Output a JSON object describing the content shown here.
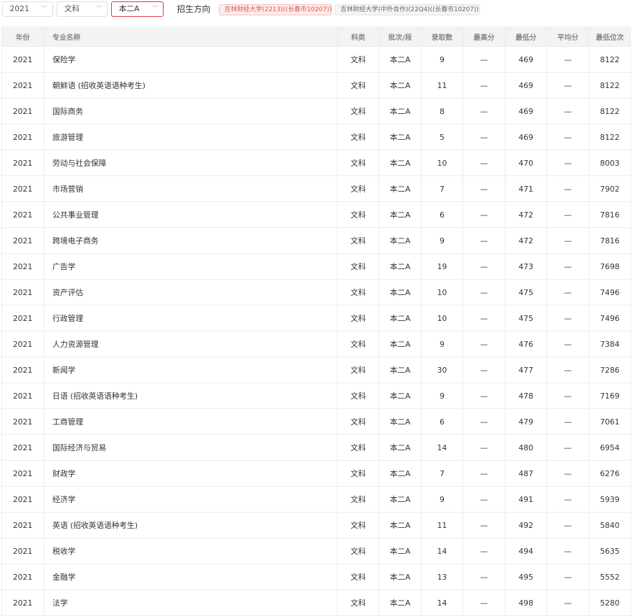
{
  "filters": {
    "year": "2021",
    "category": "文科",
    "batch": "本二A",
    "direction_label": "招生方向",
    "tags": [
      "吉林财经大学(2213)((长春市10207))",
      "吉林财经大学(中外合作)(22Q4)((长春市10207))"
    ],
    "arrow_icon": "chevron-down"
  },
  "table": {
    "headers": [
      "年份",
      "专业名称",
      "科类",
      "批次/段",
      "录取数",
      "最高分",
      "最低分",
      "平均分",
      "最低位次"
    ],
    "rows": [
      [
        "2021",
        "保险学",
        "文科",
        "本二A",
        "9",
        "—",
        "469",
        "—",
        "8122"
      ],
      [
        "2021",
        "朝鲜语 (招收英语语种考生)",
        "文科",
        "本二A",
        "11",
        "—",
        "469",
        "—",
        "8122"
      ],
      [
        "2021",
        "国际商务",
        "文科",
        "本二A",
        "8",
        "—",
        "469",
        "—",
        "8122"
      ],
      [
        "2021",
        "旅游管理",
        "文科",
        "本二A",
        "5",
        "—",
        "469",
        "—",
        "8122"
      ],
      [
        "2021",
        "劳动与社会保障",
        "文科",
        "本二A",
        "10",
        "—",
        "470",
        "—",
        "8003"
      ],
      [
        "2021",
        "市场营销",
        "文科",
        "本二A",
        "7",
        "—",
        "471",
        "—",
        "7902"
      ],
      [
        "2021",
        "公共事业管理",
        "文科",
        "本二A",
        "6",
        "—",
        "472",
        "—",
        "7816"
      ],
      [
        "2021",
        "跨境电子商务",
        "文科",
        "本二A",
        "9",
        "—",
        "472",
        "—",
        "7816"
      ],
      [
        "2021",
        "广告学",
        "文科",
        "本二A",
        "19",
        "—",
        "473",
        "—",
        "7698"
      ],
      [
        "2021",
        "资产评估",
        "文科",
        "本二A",
        "10",
        "—",
        "475",
        "—",
        "7496"
      ],
      [
        "2021",
        "行政管理",
        "文科",
        "本二A",
        "10",
        "—",
        "475",
        "—",
        "7496"
      ],
      [
        "2021",
        "人力资源管理",
        "文科",
        "本二A",
        "9",
        "—",
        "476",
        "—",
        "7384"
      ],
      [
        "2021",
        "新闻学",
        "文科",
        "本二A",
        "30",
        "—",
        "477",
        "—",
        "7286"
      ],
      [
        "2021",
        "日语 (招收英语语种考生)",
        "文科",
        "本二A",
        "9",
        "—",
        "478",
        "—",
        "7169"
      ],
      [
        "2021",
        "工商管理",
        "文科",
        "本二A",
        "6",
        "—",
        "479",
        "—",
        "7061"
      ],
      [
        "2021",
        "国际经济与贸易",
        "文科",
        "本二A",
        "14",
        "—",
        "480",
        "—",
        "6954"
      ],
      [
        "2021",
        "财政学",
        "文科",
        "本二A",
        "7",
        "—",
        "487",
        "—",
        "6276"
      ],
      [
        "2021",
        "经济学",
        "文科",
        "本二A",
        "9",
        "—",
        "491",
        "—",
        "5939"
      ],
      [
        "2021",
        "英语 (招收英语语种考生)",
        "文科",
        "本二A",
        "11",
        "—",
        "492",
        "—",
        "5840"
      ],
      [
        "2021",
        "税收学",
        "文科",
        "本二A",
        "14",
        "—",
        "494",
        "—",
        "5635"
      ],
      [
        "2021",
        "金融学",
        "文科",
        "本二A",
        "13",
        "—",
        "495",
        "—",
        "5552"
      ],
      [
        "2021",
        "法学",
        "文科",
        "本二A",
        "14",
        "—",
        "498",
        "—",
        "5280"
      ]
    ]
  }
}
